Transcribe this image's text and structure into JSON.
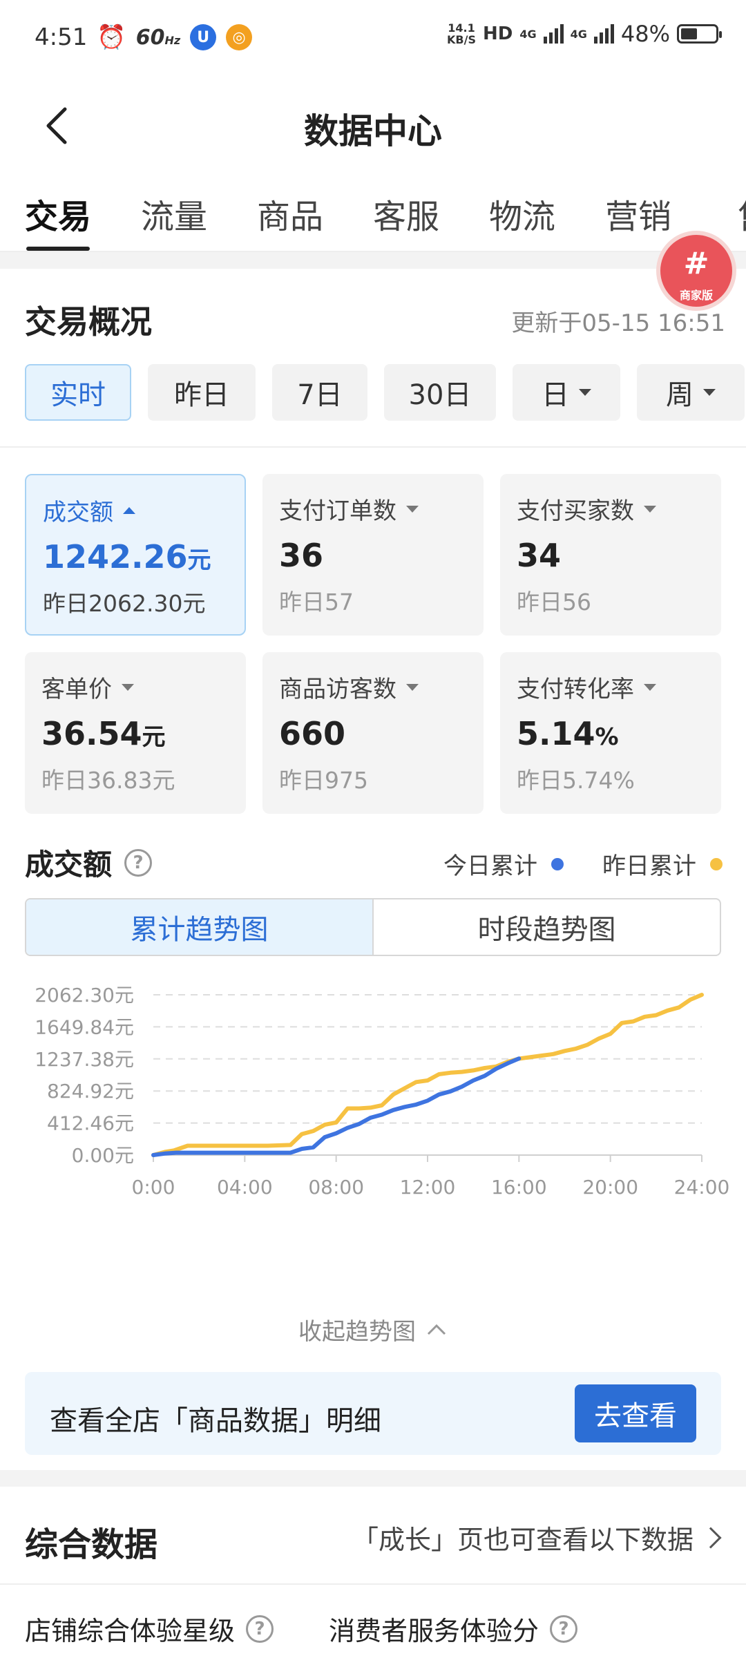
{
  "status_bar": {
    "time": "4:51",
    "refresh_rate": "60",
    "refresh_unit": "Hz",
    "net_speed_value": "14.1",
    "net_speed_unit": "KB/S",
    "hd": "HD",
    "signal1": "4G",
    "signal2": "4G",
    "battery": "48%",
    "battery_level": 0.48
  },
  "nav": {
    "title": "数据中心"
  },
  "tabs": [
    {
      "label": "交易"
    },
    {
      "label": "流量"
    },
    {
      "label": "商品"
    },
    {
      "label": "客服"
    },
    {
      "label": "物流"
    },
    {
      "label": "营销"
    },
    {
      "label": "售"
    }
  ],
  "badge": {
    "label": "商家版",
    "symbol": "#"
  },
  "overview": {
    "title": "交易概况",
    "updated": "更新于05-15 16:51",
    "periods": [
      {
        "label": "实时",
        "dropdown": false
      },
      {
        "label": "昨日",
        "dropdown": false
      },
      {
        "label": "7日",
        "dropdown": false
      },
      {
        "label": "30日",
        "dropdown": false
      },
      {
        "label": "日",
        "dropdown": true
      },
      {
        "label": "周",
        "dropdown": true
      }
    ],
    "cards": [
      {
        "label": "成交额",
        "value": "1242.26",
        "unit": "元",
        "prev": "昨日2062.30元"
      },
      {
        "label": "支付订单数",
        "value": "36",
        "unit": "",
        "prev": "昨日57"
      },
      {
        "label": "支付买家数",
        "value": "34",
        "unit": "",
        "prev": "昨日56"
      },
      {
        "label": "客单价",
        "value": "36.54",
        "unit": "元",
        "prev": "昨日36.83元"
      },
      {
        "label": "商品访客数",
        "value": "660",
        "unit": "",
        "prev": "昨日975"
      },
      {
        "label": "支付转化率",
        "value": "5.14",
        "unit": "%",
        "prev": "昨日5.74%"
      }
    ]
  },
  "chart_section": {
    "title": "成交额",
    "help": "?",
    "legend_today": "今日累计",
    "legend_yesterday": "昨日累计",
    "seg_cumulative": "累计趋势图",
    "seg_hourly": "时段趋势图",
    "collapse": "收起趋势图"
  },
  "colors": {
    "accent": "#2c6ed5",
    "today": "#3e74e0",
    "yesterday": "#f6c142"
  },
  "chart_data": {
    "type": "line",
    "title": "",
    "xlabel": "",
    "ylabel": "",
    "x_ticks": [
      "0:00",
      "04:00",
      "08:00",
      "12:00",
      "16:00",
      "20:00",
      "24:00"
    ],
    "y_ticks": [
      "0.00元",
      "412.46元",
      "824.92元",
      "1237.38元",
      "1649.84元",
      "2062.30元"
    ],
    "ylim": [
      0,
      2062.3
    ],
    "xlim": [
      0,
      24
    ],
    "grid": true,
    "series": [
      {
        "name": "昨日累计",
        "color": "#f6c142",
        "x": [
          0,
          0.5,
          0.9,
          1.5,
          2.0,
          3.0,
          4.0,
          5.0,
          6.0,
          6.5,
          7.0,
          7.5,
          8.0,
          8.5,
          9.0,
          9.5,
          10.0,
          10.5,
          11.0,
          11.5,
          12.0,
          12.5,
          13.0,
          13.5,
          14.0,
          14.5,
          15.0,
          15.5,
          16.0,
          17.0,
          17.5,
          18.0,
          18.5,
          19.0,
          19.5,
          20.0,
          20.5,
          21.0,
          21.5,
          22.0,
          22.5,
          23.0,
          23.5,
          24.0
        ],
        "values": [
          0,
          40,
          60,
          120,
          120,
          120,
          120,
          120,
          130,
          270,
          310,
          390,
          420,
          600,
          600,
          610,
          640,
          780,
          860,
          940,
          960,
          1040,
          1060,
          1070,
          1090,
          1120,
          1140,
          1200,
          1240,
          1280,
          1300,
          1340,
          1370,
          1420,
          1500,
          1560,
          1700,
          1720,
          1780,
          1800,
          1860,
          1900,
          2000,
          2062.3
        ]
      },
      {
        "name": "今日累计",
        "color": "#3e74e0",
        "x": [
          0,
          0.5,
          1.0,
          2.0,
          3.0,
          4.0,
          5.0,
          6.0,
          6.5,
          7.0,
          7.5,
          8.0,
          8.5,
          9.0,
          9.5,
          10.0,
          10.5,
          11.0,
          11.5,
          12.0,
          12.5,
          13.0,
          13.5,
          14.0,
          14.5,
          15.0,
          15.5,
          16.0
        ],
        "values": [
          0,
          20,
          30,
          30,
          30,
          30,
          30,
          30,
          80,
          100,
          230,
          280,
          350,
          400,
          480,
          520,
          580,
          620,
          650,
          700,
          780,
          820,
          880,
          960,
          1020,
          1110,
          1180,
          1242.26
        ]
      }
    ]
  },
  "banner": {
    "text": "查看全店「商品数据」明细",
    "button": "去查看"
  },
  "comprehensive": {
    "title": "综合数据",
    "link": "「成长」页也可查看以下数据",
    "items": [
      {
        "label": "店铺综合体验星级",
        "help": "?"
      },
      {
        "label": "消费者服务体验分",
        "help": "?"
      }
    ]
  }
}
